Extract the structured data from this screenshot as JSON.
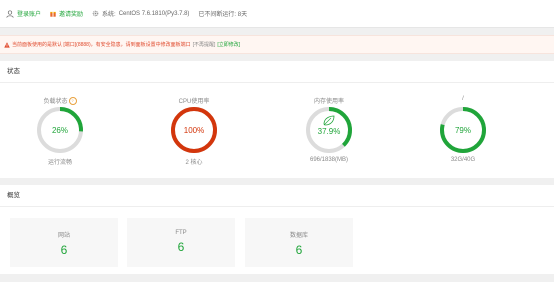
{
  "topbar": {
    "bind_account": "登录账户",
    "invite_reward": "邀请奖励",
    "system_label": "系统:",
    "system_value": "CentOS 7.6.1810(Py3.7.8)",
    "uptime": "已不间断运行: 8天"
  },
  "warning": {
    "message": "当前面板使用的是默认 [端口](8888)，有安全隐患，请到面板设置中修改面板端口",
    "ignore_label": "[不再提醒]",
    "fix_label": "[立即修改]"
  },
  "status": {
    "title": "状态",
    "gauges": [
      {
        "label": "负载状态",
        "value": "26%",
        "percent": 26,
        "color": "#20a53a",
        "sub": "运行流畅",
        "help": "?"
      },
      {
        "label": "CPU使用率",
        "value": "100%",
        "percent": 100,
        "color": "#d3360c",
        "sub": "2 核心"
      },
      {
        "label": "内存使用率",
        "value": "37.9%",
        "percent": 37.9,
        "color": "#20a53a",
        "sub": "696/1838(MB)",
        "icon": "leaf-icon"
      },
      {
        "label": "/",
        "value": "79%",
        "percent": 79,
        "color": "#20a53a",
        "sub": "32G/40G"
      }
    ]
  },
  "overview": {
    "title": "概览",
    "cards": [
      {
        "label": "网站",
        "value": "6"
      },
      {
        "label": "FTP",
        "value": "6"
      },
      {
        "label": "数据库",
        "value": "6"
      }
    ]
  },
  "colors": {
    "accent": "#20a53a",
    "danger": "#d3360c",
    "warning_text": "#e04b2e"
  }
}
